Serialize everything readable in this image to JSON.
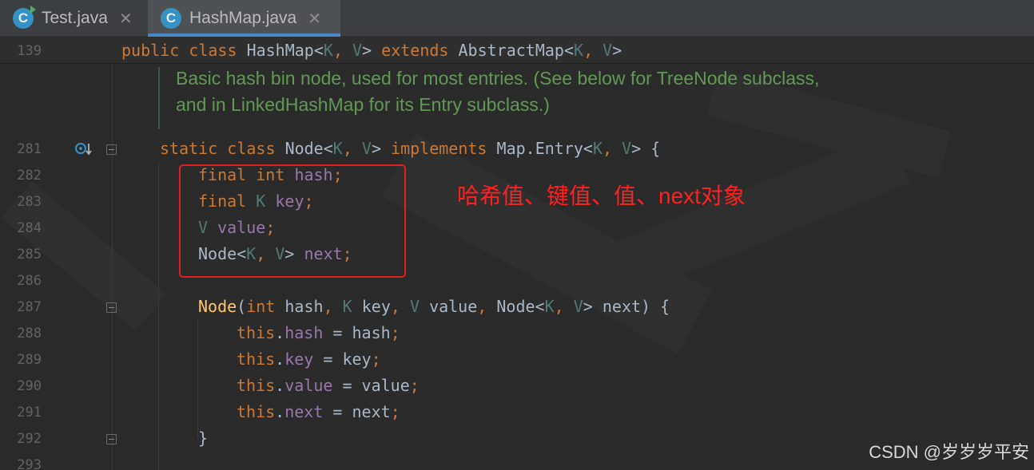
{
  "tabs": [
    {
      "icon": "C",
      "label": "Test.java",
      "close": "✕",
      "active": false
    },
    {
      "icon": "C",
      "label": "HashMap.java",
      "close": "✕",
      "active": true
    }
  ],
  "sticky_line": {
    "number": "139",
    "tokens": [
      "public",
      "class",
      "HashMap<",
      "K",
      ", ",
      "V",
      "> ",
      "extends",
      "AbstractMap<",
      "K",
      ", ",
      "V",
      ">"
    ]
  },
  "doc_comment": [
    "Basic hash bin node, used for most entries. (See below for TreeNode subclass,",
    "and in LinkedHashMap for its Entry subclass.)"
  ],
  "line_numbers": [
    "281",
    "282",
    "283",
    "284",
    "285",
    "286",
    "287",
    "288",
    "289",
    "290",
    "291",
    "292",
    "293"
  ],
  "code": {
    "l281": [
      "static",
      "class",
      "Node<",
      "K",
      ", ",
      "V",
      "> ",
      "implements",
      "Map.Entry<",
      "K",
      ", ",
      "V",
      "> {"
    ],
    "l282": [
      "final",
      "int",
      "hash",
      ";"
    ],
    "l283": [
      "final",
      "K",
      "key",
      ";"
    ],
    "l284": [
      "V",
      "value",
      ";"
    ],
    "l285": [
      "Node<",
      "K",
      ", ",
      "V",
      "> ",
      "next",
      ";"
    ],
    "l287": [
      "Node",
      "(",
      "int",
      "hash",
      ", ",
      "K",
      "key",
      ", ",
      "V",
      "value",
      ", ",
      "Node<",
      "K",
      ", ",
      "V",
      "> next) {"
    ],
    "l288": [
      "this",
      ".",
      "hash",
      " = hash",
      ";"
    ],
    "l289": [
      "this",
      ".",
      "key",
      " = key",
      ";"
    ],
    "l290": [
      "this",
      ".",
      "value",
      " = value",
      ";"
    ],
    "l291": [
      "this",
      ".",
      "next",
      " = next",
      ";"
    ],
    "l292": [
      "}"
    ]
  },
  "annotation": "哈希值、键值、值、next对象",
  "watermark": "CSDN @岁岁岁平安",
  "colors": {
    "keyword": "#cc7832",
    "type_param": "#507874",
    "field": "#9876aa",
    "doc": "#629755",
    "highlight_box": "#e02020"
  }
}
